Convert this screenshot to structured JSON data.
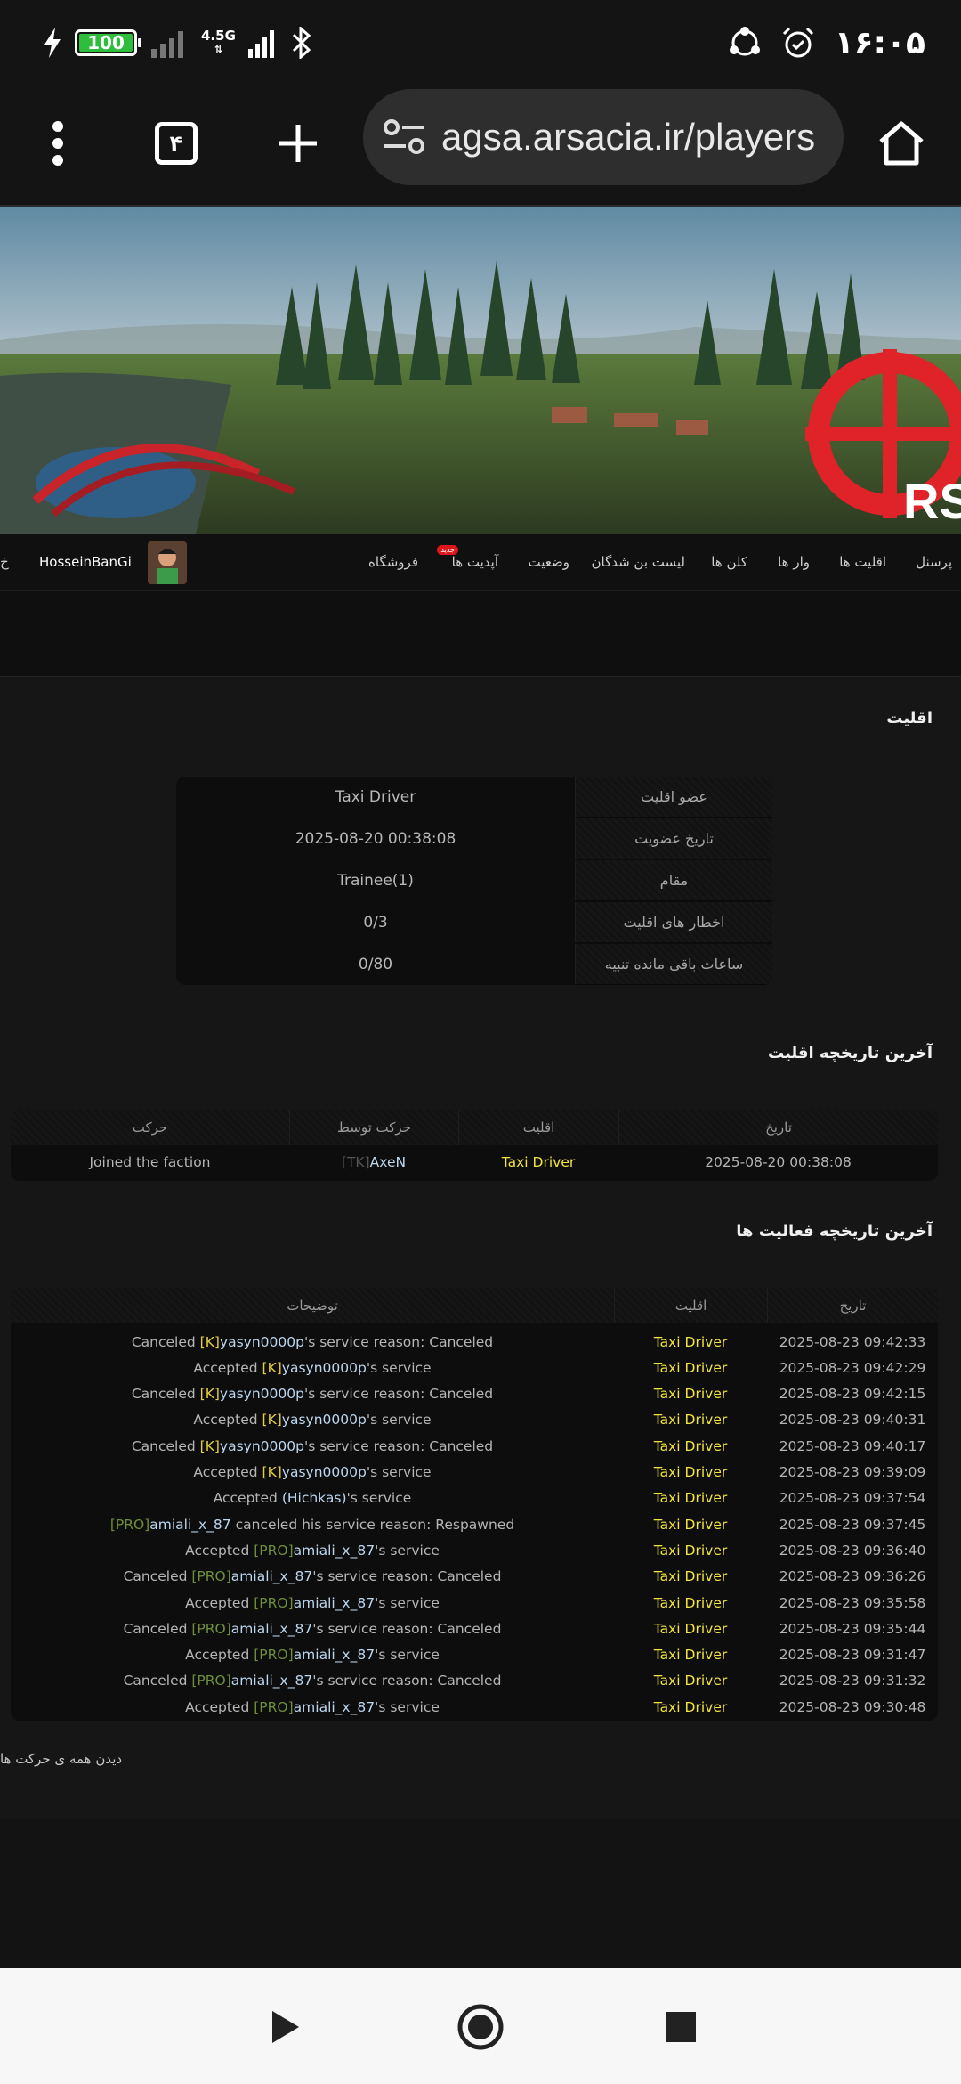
{
  "status_bar": {
    "battery": "100",
    "network": "4.5G",
    "time": "۱۶:۰۵",
    "icons": [
      "charging-icon",
      "signal-icon",
      "bluetooth-icon",
      "sync-icon",
      "alarm-icon"
    ]
  },
  "browser": {
    "tab_count": "۴",
    "url": "agsa.arsacia.ir/players"
  },
  "nav": {
    "items": [
      "پرسنل",
      "اقلیت ها",
      "وار ها",
      "کلن ها",
      "لیست بن شدگان",
      "وضعیت",
      "آپدیت ها",
      "فروشگاه"
    ],
    "new_badge": "جدید",
    "username": "HosseinBanGi",
    "edge_text": "خ"
  },
  "faction": {
    "title": "اقلیت",
    "rows": [
      {
        "label": "عضو اقلیت",
        "value": "Taxi Driver"
      },
      {
        "label": "تاریخ عضویت",
        "value": "2025-08-20 00:38:08"
      },
      {
        "label": "مقام",
        "value": "Trainee(1)"
      },
      {
        "label": "اخطار های اقلیت",
        "value": "0/3"
      },
      {
        "label": "ساعات باقی مانده تنبیه",
        "value": "0/80"
      }
    ]
  },
  "faction_history": {
    "title": "آخرین تاریخچه اقلیت",
    "headers": {
      "date": "تاریخ",
      "faction": "اقلیت",
      "by": "حرکت توسط",
      "action": "حرکت"
    },
    "rows": [
      {
        "date": "2025-08-20 00:38:08",
        "faction": "Taxi Driver",
        "by_tag": "[TK]",
        "by_name": "AxeN",
        "action": "Joined the faction"
      }
    ]
  },
  "activity_history": {
    "title": "آخرین تاریخچه فعالیت ها",
    "headers": {
      "date": "تاریخ",
      "faction": "اقلیت",
      "desc": "توضیحات"
    },
    "rows": [
      {
        "date": "2025-08-23 09:42:33",
        "faction": "Taxi Driver",
        "pre": "Canceled ",
        "tag": "[K]",
        "name": "yasyn0000p",
        "post": "'s service reason: Canceled"
      },
      {
        "date": "2025-08-23 09:42:29",
        "faction": "Taxi Driver",
        "pre": "Accepted ",
        "tag": "[K]",
        "name": "yasyn0000p",
        "post": "'s service"
      },
      {
        "date": "2025-08-23 09:42:15",
        "faction": "Taxi Driver",
        "pre": "Canceled ",
        "tag": "[K]",
        "name": "yasyn0000p",
        "post": "'s service reason: Canceled"
      },
      {
        "date": "2025-08-23 09:40:31",
        "faction": "Taxi Driver",
        "pre": "Accepted ",
        "tag": "[K]",
        "name": "yasyn0000p",
        "post": "'s service"
      },
      {
        "date": "2025-08-23 09:40:17",
        "faction": "Taxi Driver",
        "pre": "Canceled ",
        "tag": "[K]",
        "name": "yasyn0000p",
        "post": "'s service reason: Canceled"
      },
      {
        "date": "2025-08-23 09:39:09",
        "faction": "Taxi Driver",
        "pre": "Accepted ",
        "tag": "[K]",
        "name": "yasyn0000p",
        "post": "'s service"
      },
      {
        "date": "2025-08-23 09:37:54",
        "faction": "Taxi Driver",
        "pre": "Accepted ",
        "tag": "",
        "name": "(Hichkas)",
        "post": "'s service"
      },
      {
        "date": "2025-08-23 09:37:45",
        "faction": "Taxi Driver",
        "pre": "",
        "tag": "[PRO]",
        "name": "amiali_x_87",
        "post": " canceled his service reason: Respawned"
      },
      {
        "date": "2025-08-23 09:36:40",
        "faction": "Taxi Driver",
        "pre": "Accepted ",
        "tag": "[PRO]",
        "name": "amiali_x_87",
        "post": "'s service"
      },
      {
        "date": "2025-08-23 09:36:26",
        "faction": "Taxi Driver",
        "pre": "Canceled ",
        "tag": "[PRO]",
        "name": "amiali_x_87",
        "post": "'s service reason: Canceled"
      },
      {
        "date": "2025-08-23 09:35:58",
        "faction": "Taxi Driver",
        "pre": "Accepted ",
        "tag": "[PRO]",
        "name": "amiali_x_87",
        "post": "'s service"
      },
      {
        "date": "2025-08-23 09:35:44",
        "faction": "Taxi Driver",
        "pre": "Canceled ",
        "tag": "[PRO]",
        "name": "amiali_x_87",
        "post": "'s service reason: Canceled"
      },
      {
        "date": "2025-08-23 09:31:47",
        "faction": "Taxi Driver",
        "pre": "Accepted ",
        "tag": "[PRO]",
        "name": "amiali_x_87",
        "post": "'s service"
      },
      {
        "date": "2025-08-23 09:31:32",
        "faction": "Taxi Driver",
        "pre": "Canceled ",
        "tag": "[PRO]",
        "name": "amiali_x_87",
        "post": "'s service reason: Canceled"
      },
      {
        "date": "2025-08-23 09:30:48",
        "faction": "Taxi Driver",
        "pre": "Accepted ",
        "tag": "[PRO]",
        "name": "amiali_x_87",
        "post": "'s service"
      }
    ],
    "see_all": "دیدن همه ی حرکت ها"
  },
  "banner": {
    "logo_text": "RS"
  }
}
